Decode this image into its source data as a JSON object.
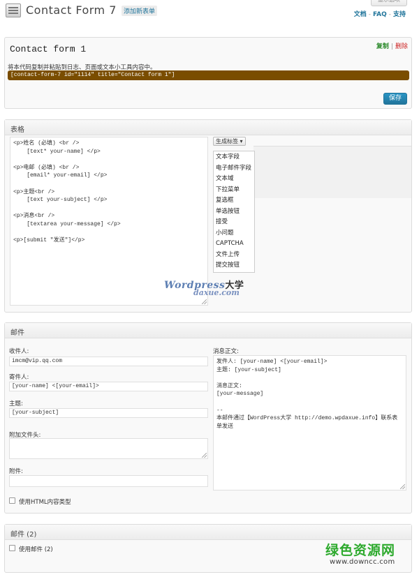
{
  "header": {
    "title": "Contact Form 7",
    "add_new": "添加新表单",
    "screen_options": "显示选项",
    "links": [
      "文档",
      "FAQ",
      "支持"
    ]
  },
  "form_box": {
    "title": "Contact form 1",
    "copy": "复制",
    "delete": "删除",
    "instruction": "将本代码复制并粘贴到日志、页面或文本小工具内容中。",
    "shortcode": "[contact-form-7 id=\"1114\" title=\"Contact form 1\"]",
    "save": "保存"
  },
  "form_section": {
    "heading": "表格",
    "editor_content": "<p>姓名 (必填) <br />\n    [text* your-name] </p>\n\n<p>电邮 (必填) <br />\n    [email* your-email] </p>\n\n<p>主题<br />\n    [text your-subject] </p>\n\n<p>消息<br />\n    [textarea your-message] </p>\n\n<p>[submit \"发送\"]</p>",
    "generate_tag": "生成标签",
    "tag_menu": [
      "文本字段",
      "电子邮件字段",
      "文本域",
      "下拉菜单",
      "复选框",
      "单选按钮",
      "接受",
      "小问题",
      "CAPTCHA",
      "文件上传",
      "提交按钮"
    ]
  },
  "watermark": {
    "logo_word": "Wordpress",
    "logo_cn": "大学",
    "logo_sub": "daxue.com"
  },
  "mail_section": {
    "heading": "邮件",
    "to_label": "收件人:",
    "to_value": "imcm@vip.qq.com",
    "from_label": "寄件人:",
    "from_value": "[your-name] <[your-email]>",
    "subject_label": "主题:",
    "subject_value": "[your-subject]",
    "headers_label": "附加文件头:",
    "headers_value": "",
    "attachments_label": "附件:",
    "attachments_value": "",
    "html_checkbox": "使用HTML内容类型",
    "body_label": "消息正文:",
    "body_value": "发件人: [your-name] <[your-email]>\n主题: [your-subject]\n\n消息正文:\n[your-message]\n\n--\n本邮件通过【WordPress大学 http://demo.wpdaxue.info】联系表单发送"
  },
  "mail2_section": {
    "heading": "邮件 (2)",
    "checkbox": "使用邮件 (2)"
  },
  "site_watermark": {
    "name": "绿色资源网",
    "url": "www.downcc.com"
  }
}
